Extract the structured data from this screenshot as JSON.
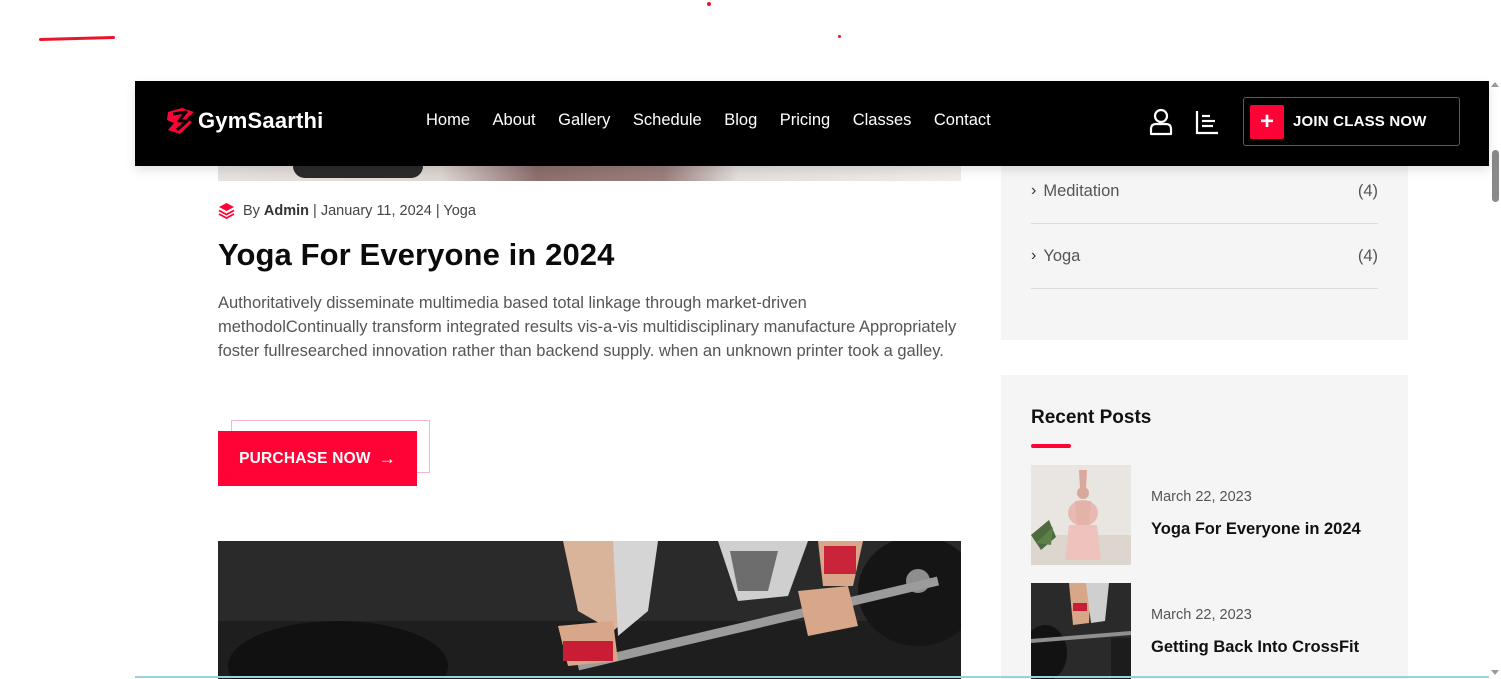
{
  "brand": {
    "name": "GymSaarthi",
    "accent": "#ff0336",
    "header_bg": "#000000"
  },
  "nav": {
    "items": [
      "Home",
      "About",
      "Gallery",
      "Schedule",
      "Blog",
      "Pricing",
      "Classes",
      "Contact"
    ]
  },
  "header_actions": {
    "user_icon": "user-icon",
    "menu_icon": "bars-icon",
    "join_plus": "+",
    "join_label": "JOIN CLASS NOW"
  },
  "post": {
    "by": "By",
    "author": "Admin",
    "date_category": "| January 11, 2024 | Yoga",
    "title": "Yoga For Everyone in 2024",
    "body": "Authoritatively disseminate multimedia based total linkage through market-driven methodolContinually transform integrated results vis-a-vis multidisciplinary manufacture Appropriately foster fullresearched innovation rather than backend supply. when an unknown printer took a galley.",
    "button_label": "PURCHASE NOW",
    "button_arrow": "→"
  },
  "categories": [
    {
      "chevron": "›",
      "name": "Meditation",
      "count": "(4)"
    },
    {
      "chevron": "›",
      "name": "Yoga",
      "count": "(4)"
    }
  ],
  "recent_posts": {
    "title": "Recent Posts",
    "items": [
      {
        "date": "March 22, 2023",
        "title": "Yoga For Everyone in 2024"
      },
      {
        "date": "March 22, 2023",
        "title": "Getting Back Into CrossFit"
      }
    ]
  }
}
